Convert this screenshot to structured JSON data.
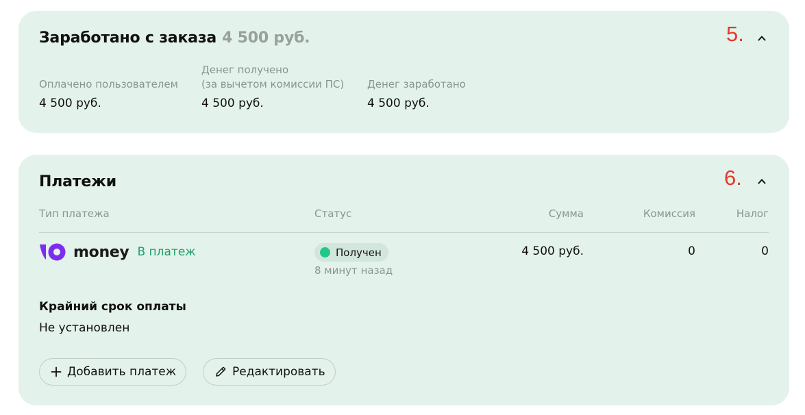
{
  "earned_card": {
    "title": "Заработано с заказа",
    "amount": "4 500 руб.",
    "step": "5.",
    "columns": [
      {
        "label_line1": "",
        "label_line2": "Оплачено пользователем",
        "value": "4 500 руб."
      },
      {
        "label_line1": "Денег получено",
        "label_line2": "(за вычетом комиссии ПС)",
        "value": "4 500 руб."
      },
      {
        "label_line1": "",
        "label_line2": "Денег заработано",
        "value": "4 500 руб."
      }
    ]
  },
  "payments_card": {
    "title": "Платежи",
    "step": "6.",
    "headers": {
      "type": "Тип платежа",
      "status": "Статус",
      "sum": "Сумма",
      "commission": "Комиссия",
      "tax": "Налог"
    },
    "rows": [
      {
        "provider": "money",
        "type": "В платеж",
        "status": "Получен",
        "time": "8 минут назад",
        "sum": "4 500 руб.",
        "commission": "0",
        "tax": "0"
      }
    ],
    "deadline_label": "Крайний срок оплаты",
    "deadline_value": "Не установлен",
    "buttons": {
      "add": "Добавить платеж",
      "edit": "Редактировать"
    }
  },
  "icons": {
    "collapse": "chevron-up-icon",
    "add": "plus-icon",
    "edit": "pencil-icon",
    "provider_logo": "yoomoney-logo-icon",
    "status": "status-dot-icon"
  },
  "colors": {
    "card_bg": "#e3f2eb",
    "step_number": "#e03b2f",
    "status_dot": "#1ec98a",
    "payment_type": "#1fa06b",
    "logo_purple": "#7b2ef0"
  }
}
